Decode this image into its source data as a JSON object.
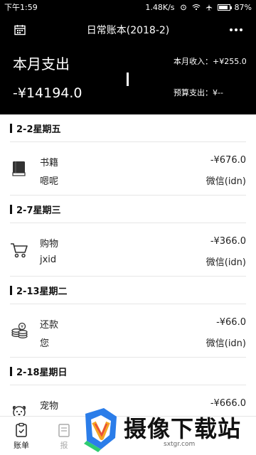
{
  "status_bar": {
    "time": "下午1:59",
    "speed": "1.48K/s",
    "battery": "87%",
    "battery_level": 0.87
  },
  "toolbar": {
    "title": "日常账本(2018-2)"
  },
  "summary": {
    "month_label": "本月支出",
    "month_amount": "-¥14194.0",
    "income": "本月收入：+¥255.0",
    "budget": "预算支出：¥--"
  },
  "days": [
    {
      "header": "2-2星期五",
      "entries": [
        {
          "icon": "book-icon",
          "category": "书籍",
          "note": "嗯呢",
          "amount": "-¥676.0",
          "account": "微信(idn)"
        }
      ]
    },
    {
      "header": "2-7星期三",
      "entries": [
        {
          "icon": "cart-icon",
          "category": "购物",
          "note": "jxid",
          "amount": "-¥366.0",
          "account": "微信(idn)"
        }
      ]
    },
    {
      "header": "2-13星期二",
      "entries": [
        {
          "icon": "coins-icon",
          "category": "还款",
          "note": "您",
          "amount": "-¥66.0",
          "account": "微信(idn)"
        }
      ]
    },
    {
      "header": "2-18星期日",
      "entries": [
        {
          "icon": "pet-icon",
          "category": "宠物",
          "note": "",
          "amount": "-¥666.0",
          "account": ""
        }
      ]
    }
  ],
  "bottom_nav": {
    "tabs": [
      {
        "label": "账单",
        "icon": "bill-icon"
      },
      {
        "label": "报",
        "icon": "report-icon"
      }
    ]
  },
  "watermark": {
    "text": "摄像下载站",
    "url": "sxtgr.com"
  },
  "colors": {
    "header_bg": "#000000",
    "header_fg": "#ffffff",
    "separator": "#e6e6e6"
  }
}
